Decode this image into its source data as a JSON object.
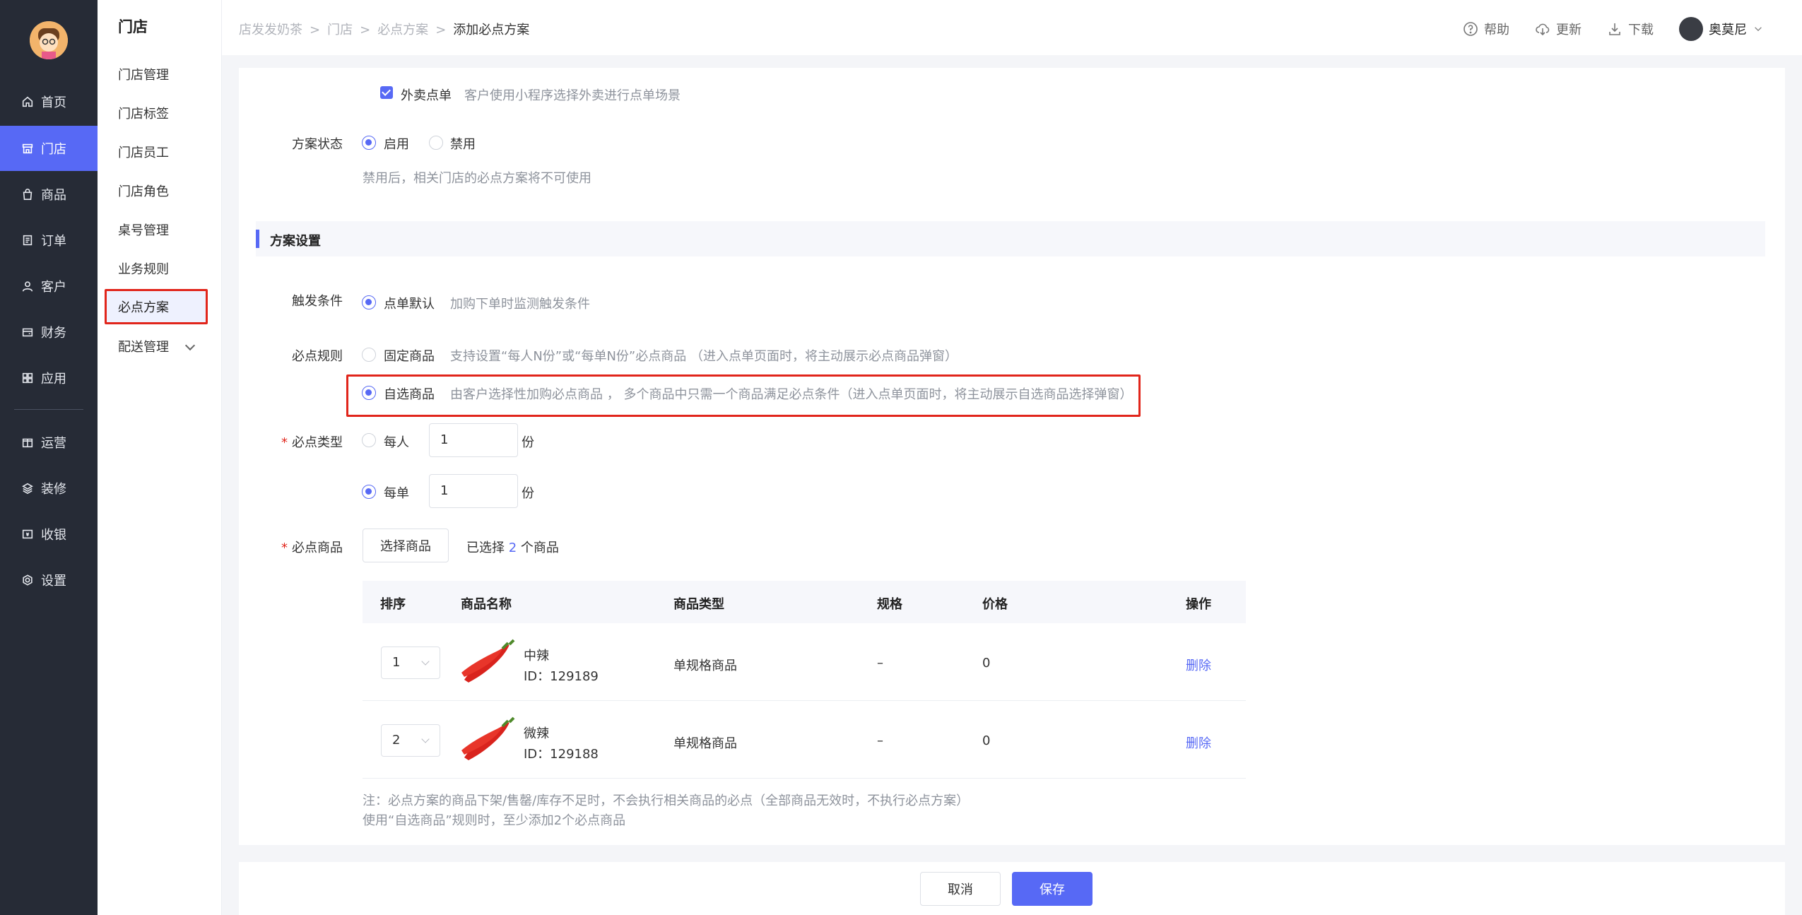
{
  "nav": {
    "items": [
      {
        "label": "首页",
        "icon": "home-icon"
      },
      {
        "label": "门店",
        "icon": "store-icon"
      },
      {
        "label": "商品",
        "icon": "bag-icon"
      },
      {
        "label": "订单",
        "icon": "order-icon"
      },
      {
        "label": "客户",
        "icon": "user-icon"
      },
      {
        "label": "财务",
        "icon": "wallet-icon"
      },
      {
        "label": "应用",
        "icon": "apps-icon"
      },
      {
        "label": "运营",
        "icon": "gift-icon"
      },
      {
        "label": "装修",
        "icon": "layers-icon"
      },
      {
        "label": "收银",
        "icon": "cashier-icon"
      },
      {
        "label": "设置",
        "icon": "gear-icon"
      }
    ],
    "active": "门店"
  },
  "subnav": {
    "title": "门店",
    "items": [
      "门店管理",
      "门店标签",
      "门店员工",
      "门店角色",
      "桌号管理",
      "业务规则",
      "必点方案",
      "配送管理"
    ],
    "active": "必点方案"
  },
  "breadcrumb": [
    "店发发奶茶",
    "门店",
    "必点方案",
    "添加必点方案"
  ],
  "top_actions": {
    "help": "帮助",
    "update": "更新",
    "download": "下载",
    "user": "奥莫尼"
  },
  "form": {
    "takeout": {
      "label": "外卖点单",
      "hint": "客户使用小程序选择外卖进行点单场景",
      "checked": true
    },
    "status": {
      "label": "方案状态",
      "options": [
        "启用",
        "禁用"
      ],
      "selected": "启用",
      "hint": "禁用后，相关门店的必点方案将不可使用"
    },
    "section_title": "方案设置",
    "trigger": {
      "label": "触发条件",
      "option": "点单默认",
      "hint": "加购下单时监测触发条件"
    },
    "rule": {
      "label": "必点规则",
      "fixed": {
        "option": "固定商品",
        "hint": "支持设置“每人N份”或“每单N份”必点商品 （进入点单页面时，将主动展示必点商品弹窗）"
      },
      "optional": {
        "option": "自选商品",
        "hint": "由客户选择性加购必点商品 ， 多个商品中只需一个商品满足必点条件（进入点单页面时，将主动展示自选商品选择弹窗）"
      },
      "selected": "自选商品"
    },
    "type": {
      "label": "必点类型",
      "per_person": {
        "option": "每人",
        "value": "1",
        "unit": "份"
      },
      "per_order": {
        "option": "每单",
        "value": "1",
        "unit": "份"
      },
      "selected": "每单"
    },
    "products": {
      "label": "必点商品",
      "select_button": "选择商品",
      "selected_prefix": "已选择",
      "selected_count": "2",
      "selected_suffix": "个商品"
    }
  },
  "table": {
    "headers": [
      "排序",
      "商品名称",
      "商品类型",
      "规格",
      "价格",
      "操作"
    ],
    "rows": [
      {
        "sort": "1",
        "name": "中辣",
        "id": "ID：129189",
        "type": "单规格商品",
        "spec": "–",
        "price": "0",
        "action": "删除"
      },
      {
        "sort": "2",
        "name": "微辣",
        "id": "ID：129188",
        "type": "单规格商品",
        "spec": "–",
        "price": "0",
        "action": "删除"
      }
    ]
  },
  "notes": [
    "注：必点方案的商品下架/售罄/库存不足时，不会执行相关商品的必点（全部商品无效时，不执行必点方案）",
    "使用“自选商品”规则时，至少添加2个必点商品"
  ],
  "footer": {
    "cancel": "取消",
    "save": "保存"
  },
  "colors": {
    "accent": "#5769f5",
    "nav_bg": "#262b36",
    "highlight": "#e1251b"
  }
}
